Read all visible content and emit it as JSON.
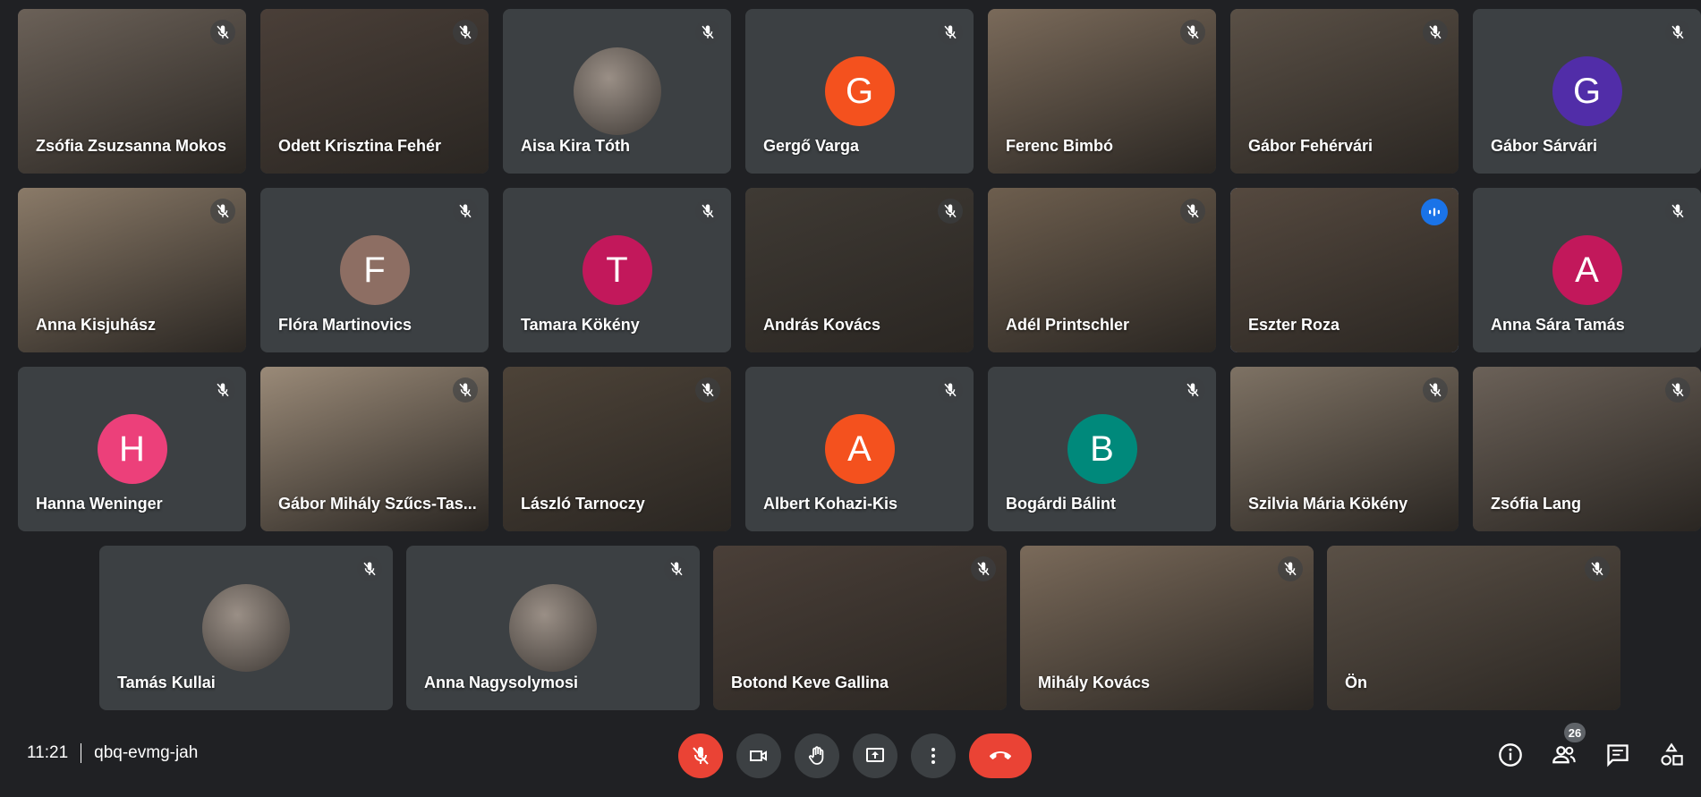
{
  "participants_row1": [
    {
      "name": "Zsófia Zsuzsanna Mokos",
      "kind": "video"
    },
    {
      "name": "Odett Krisztina Fehér",
      "kind": "video"
    },
    {
      "name": "Aisa Kira Tóth",
      "kind": "picture"
    },
    {
      "name": "Gergő Varga",
      "kind": "letter",
      "letter": "G",
      "color": "#f4511e"
    },
    {
      "name": "Ferenc Bimbó",
      "kind": "video"
    },
    {
      "name": "Gábor Fehérvári",
      "kind": "video"
    },
    {
      "name": "Gábor Sárvári",
      "kind": "letter",
      "letter": "G",
      "color": "#512da8"
    }
  ],
  "participants_row2": [
    {
      "name": "Anna Kisjuhász",
      "kind": "video"
    },
    {
      "name": "Flóra Martinovics",
      "kind": "letter",
      "letter": "F",
      "color": "#8d6e63"
    },
    {
      "name": "Tamara Kökény",
      "kind": "letter",
      "letter": "T",
      "color": "#c2185b"
    },
    {
      "name": "András Kovács",
      "kind": "video"
    },
    {
      "name": "Adél Printschler",
      "kind": "video"
    },
    {
      "name": "Eszter Roza",
      "kind": "video",
      "speaking": true
    },
    {
      "name": "Anna Sára Tamás",
      "kind": "letter",
      "letter": "A",
      "color": "#c2185b"
    }
  ],
  "participants_row3": [
    {
      "name": "Hanna Weninger",
      "kind": "letter",
      "letter": "H",
      "color": "#ec407a"
    },
    {
      "name": "Gábor Mihály Szűcs-Tas...",
      "kind": "video"
    },
    {
      "name": "László Tarnoczy",
      "kind": "video"
    },
    {
      "name": "Albert Kohazi-Kis",
      "kind": "letter",
      "letter": "A",
      "color": "#f4511e"
    },
    {
      "name": "Bogárdi Bálint",
      "kind": "letter",
      "letter": "B",
      "color": "#00897b"
    },
    {
      "name": "Szilvia Mária Kökény",
      "kind": "video"
    },
    {
      "name": "Zsófia Lang",
      "kind": "video"
    }
  ],
  "participants_row4": [
    {
      "name": "Tamás Kullai",
      "kind": "picture"
    },
    {
      "name": "Anna Nagysolymosi",
      "kind": "picture"
    },
    {
      "name": "Botond Keve Gallina",
      "kind": "video"
    },
    {
      "name": "Mihály Kovács",
      "kind": "video"
    },
    {
      "name": "Ön",
      "kind": "video"
    }
  ],
  "meeting": {
    "time": "11:21",
    "code": "qbq-evmg-jah"
  },
  "participants_count": "26",
  "controls": [
    "mic-muted-icon",
    "camera-icon",
    "raise-hand-icon",
    "present-icon",
    "more-icon",
    "end-call-icon"
  ],
  "right_controls": [
    "info-icon",
    "people-icon",
    "chat-icon",
    "activities-icon"
  ],
  "colors": {
    "background": "#202124",
    "tile": "#3c4043",
    "danger": "#ea4335",
    "speaking": "#8ab4f8"
  }
}
